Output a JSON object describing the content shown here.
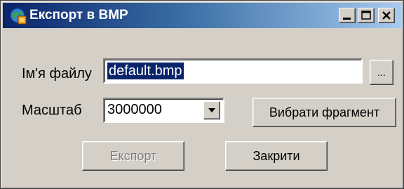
{
  "window": {
    "title": "Експорт в BMP",
    "controls": {
      "minimize_icon": "minimize-icon",
      "maximize_icon": "maximize-icon",
      "close_icon": "close-icon"
    }
  },
  "form": {
    "filename_label": "Ім'я файлу",
    "filename_value": "default.bmp",
    "browse_label": "...",
    "scale_label": "Масштаб",
    "scale_value": "3000000",
    "select_fragment_label": "Вибрати фрагмент"
  },
  "actions": {
    "export_label": "Експорт",
    "export_enabled": false,
    "close_label": "Закрити"
  },
  "colors": {
    "titlebar_start": "#0a246a",
    "titlebar_end": "#a6caf0",
    "face": "#d4d0c8",
    "selection": "#0a246a"
  }
}
